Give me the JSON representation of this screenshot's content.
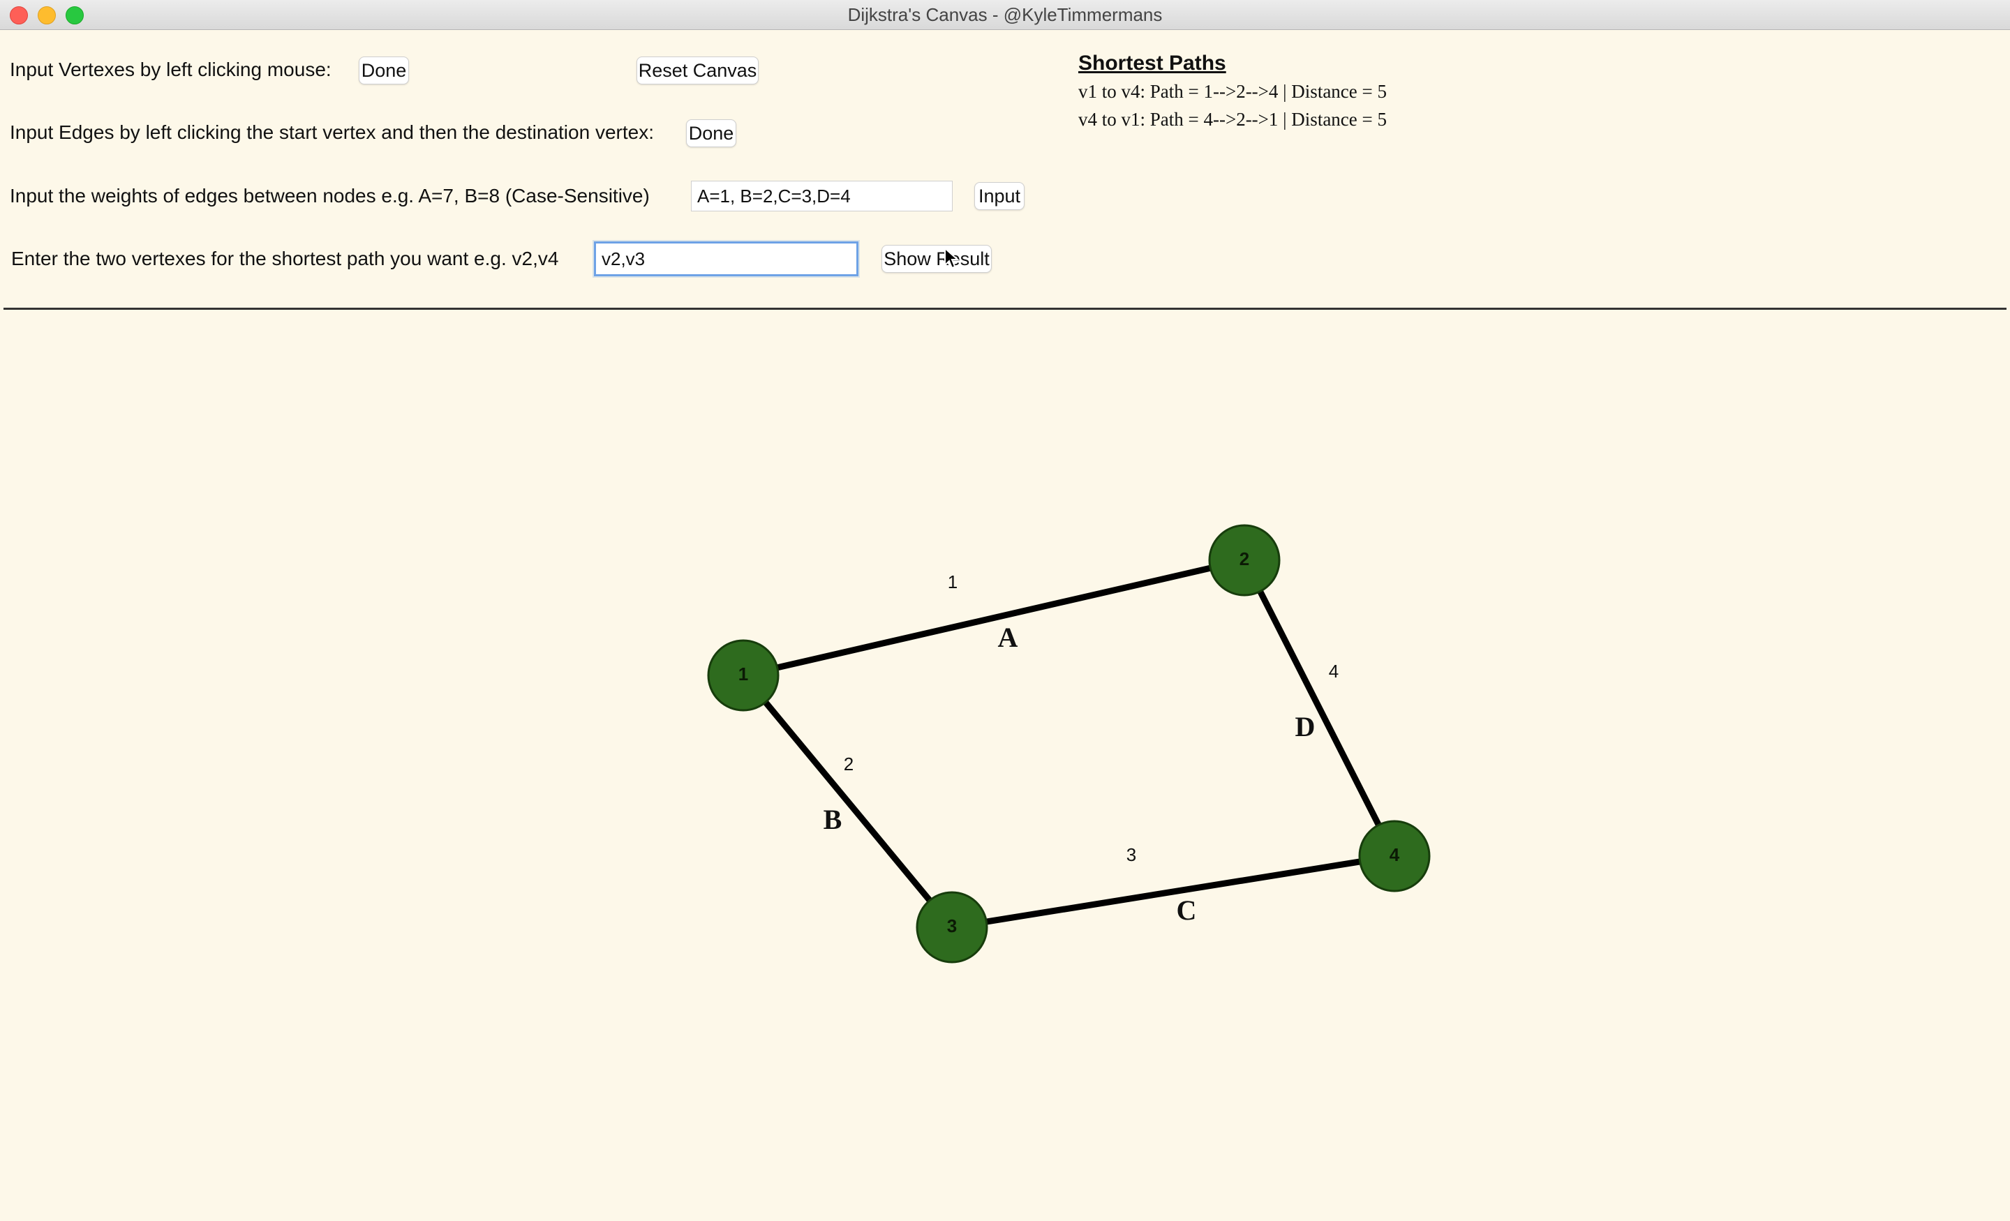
{
  "window": {
    "title": "Dijkstra's Canvas - @KyleTimmermans"
  },
  "controls": {
    "vertex_label": "Input Vertexes by left clicking mouse:",
    "vertex_done": "Done",
    "reset": "Reset Canvas",
    "edge_label": "Input Edges by left clicking the start vertex and then the destination vertex:",
    "edge_done": "Done",
    "weights_label": "Input the weights of edges between nodes e.g. A=7, B=8 (Case-Sensitive)",
    "weights_value": "A=1, B=2,C=3,D=4",
    "weights_button": "Input",
    "path_label": "Enter the two vertexes for the shortest path you want e.g. v2,v4",
    "path_value": "v2,v3",
    "path_button": "Show Result"
  },
  "results": {
    "title": "Shortest Paths",
    "lines": [
      "v1 to v4: Path = 1-->2-->4 | Distance = 5",
      "v4 to v1: Path = 4-->2-->1 | Distance = 5"
    ]
  },
  "graph": {
    "node_color": "#2e6b1e",
    "vertices": [
      "1",
      "2",
      "3",
      "4"
    ],
    "edges": [
      {
        "name": "A",
        "from": "1",
        "to": "2",
        "weight": "1"
      },
      {
        "name": "B",
        "from": "1",
        "to": "3",
        "weight": "2"
      },
      {
        "name": "C",
        "from": "3",
        "to": "4",
        "weight": "3"
      },
      {
        "name": "D",
        "from": "2",
        "to": "4",
        "weight": "4"
      }
    ]
  }
}
